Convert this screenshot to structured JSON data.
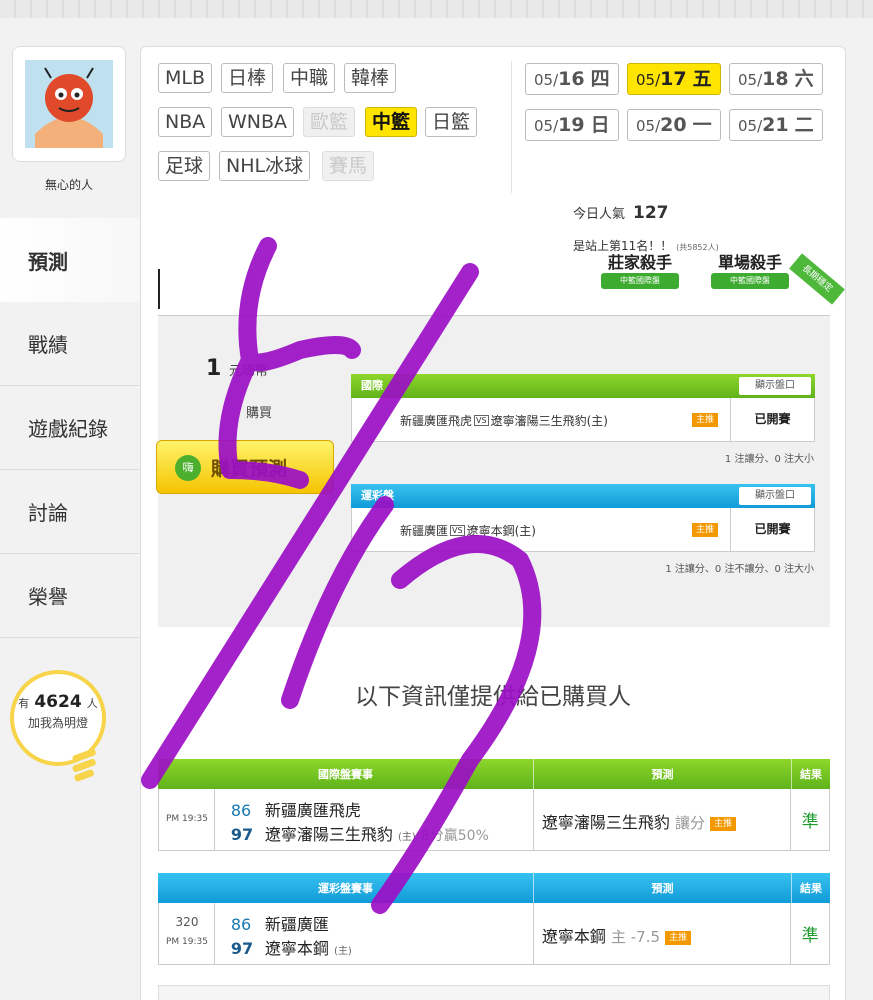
{
  "user": {
    "name": "無心的人"
  },
  "nav": [
    {
      "label": "預測",
      "active": true
    },
    {
      "label": "戰績"
    },
    {
      "label": "遊戲紀錄"
    },
    {
      "label": "討論"
    },
    {
      "label": "榮譽"
    }
  ],
  "fans": {
    "prefix": "有",
    "count": "4624",
    "suffix": "人",
    "text": "加我為明燈"
  },
  "sports": [
    "MLB",
    "日棒",
    "中職",
    "韓棒",
    "NBA",
    "WNBA",
    "歐籃",
    "中籃",
    "日籃",
    "足球",
    "NHL冰球",
    "賽馬"
  ],
  "dates": [
    {
      "md": "05/",
      "d": "16",
      "wd": "四"
    },
    {
      "md": "05/",
      "d": "17",
      "wd": "五"
    },
    {
      "md": "05/",
      "d": "18",
      "wd": "六"
    },
    {
      "md": "05/",
      "d": "19",
      "wd": "日"
    },
    {
      "md": "05/",
      "d": "20",
      "wd": "一"
    },
    {
      "md": "05/",
      "d": "21",
      "wd": "二"
    }
  ],
  "stats": {
    "pop_label": "今日人氣",
    "pop_value": "127",
    "rank_text": "是站上第11名！！",
    "rank_total": "(共5852人)"
  },
  "badges": {
    "b1_title": "莊家殺手",
    "b1_ribbon": "中籃國際盤",
    "b2_title": "單場殺手",
    "b2_ribbon": "中籃國際盤",
    "long": "長期穩定"
  },
  "purchase": {
    "coins": "1",
    "coin_unit": "元嗨幣",
    "bought": "購買",
    "button": "購買預測",
    "button_icon": "嗨"
  },
  "games": {
    "intl": {
      "head": "國際",
      "show": "顯示盤口",
      "home": "新疆廣匯飛虎",
      "vs": "VS",
      "away": "遼寧瀋陽三生飛豹(主)",
      "tag": "主推",
      "status": "已開賽",
      "summary": "1 注讓分、0 注大小"
    },
    "lottery": {
      "head": "運彩盤",
      "show": "顯示盤口",
      "home": "新疆廣匯",
      "vs": "VS",
      "away": "遼寧本鋼(主)",
      "tag": "主推",
      "status": "已開賽",
      "summary": "1 注讓分、0 注不讓分、0 注大小"
    }
  },
  "notice": "以下資訊僅提供給已購買人",
  "results": {
    "intl": {
      "headers": [
        "國際盤賽事",
        "預測",
        "結果"
      ],
      "time": "PM 19:35",
      "num1": "86",
      "team1": "新疆廣匯飛虎",
      "num2": "97",
      "team2": "遼寧瀋陽三生飛豹",
      "team2_note": "(主)",
      "team2_ext": "8分贏50%",
      "pick": "遼寧瀋陽三生飛豹",
      "pick_type": "讓分",
      "pick_tag": "主推",
      "result": "準"
    },
    "lottery": {
      "headers": [
        "運彩盤賽事",
        "預測",
        "結果"
      ],
      "game_no": "320",
      "time": "PM 19:35",
      "num1": "86",
      "team1": "新疆廣匯",
      "num2": "97",
      "team2": "遼寧本鋼",
      "team2_note": "(主)",
      "pick": "遼寧本鋼",
      "pick_type": "主 -7.5",
      "pick_tag": "主推",
      "result": "準"
    }
  },
  "colors": {
    "accent_yellow": "#ffe400",
    "green_header": "#6ec21f",
    "blue_header": "#1aa8e0",
    "annotation_purple": "#9b0fc5",
    "result_green": "#1e9b2b"
  }
}
